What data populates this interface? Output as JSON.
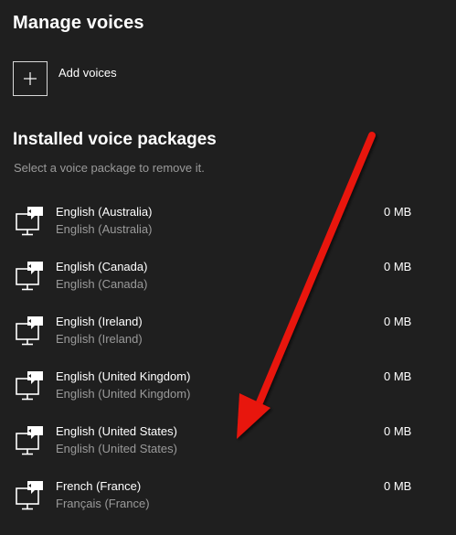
{
  "header": {
    "title": "Manage voices"
  },
  "add": {
    "label": "Add voices",
    "icon": "plus-icon"
  },
  "installed": {
    "title": "Installed voice packages",
    "hint": "Select a voice package to remove it."
  },
  "voices": [
    {
      "name": "English (Australia)",
      "native": "English (Australia)",
      "size": "0 MB"
    },
    {
      "name": "English (Canada)",
      "native": "English (Canada)",
      "size": "0 MB"
    },
    {
      "name": "English (Ireland)",
      "native": "English (Ireland)",
      "size": "0 MB"
    },
    {
      "name": "English (United Kingdom)",
      "native": "English (United Kingdom)",
      "size": "0 MB"
    },
    {
      "name": "English (United States)",
      "native": "English (United States)",
      "size": "0 MB"
    },
    {
      "name": "French (France)",
      "native": "Français (France)",
      "size": "0 MB"
    }
  ],
  "colors": {
    "background": "#1f1f1f",
    "subtext": "#9a9a9a",
    "annotation_arrow": "#e8120c"
  }
}
